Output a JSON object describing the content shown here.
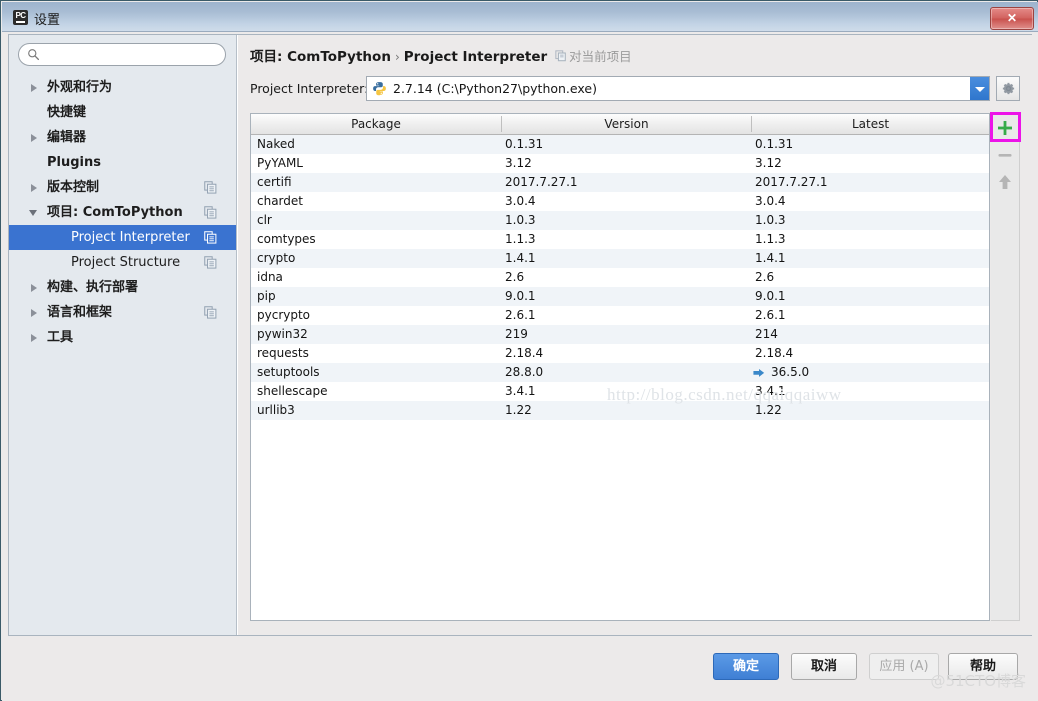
{
  "window": {
    "title": "设置",
    "app_icon": "pycharm-icon",
    "close_label": "✕"
  },
  "sidebar": {
    "search": {
      "value": "",
      "placeholder": "",
      "icon": "search-icon"
    },
    "items": [
      {
        "label": "外观和行为",
        "arrow": "collapsed",
        "bold": true,
        "child": false,
        "selected": false,
        "mod_icon": false
      },
      {
        "label": "快捷键",
        "arrow": "none",
        "bold": true,
        "child": false,
        "selected": false,
        "mod_icon": false
      },
      {
        "label": "编辑器",
        "arrow": "collapsed",
        "bold": true,
        "child": false,
        "selected": false,
        "mod_icon": false
      },
      {
        "label": "Plugins",
        "arrow": "none",
        "bold": true,
        "child": false,
        "selected": false,
        "mod_icon": false
      },
      {
        "label": "版本控制",
        "arrow": "collapsed",
        "bold": true,
        "child": false,
        "selected": false,
        "mod_icon": true
      },
      {
        "label": "项目: ComToPython",
        "arrow": "expanded",
        "bold": true,
        "child": false,
        "selected": false,
        "mod_icon": true
      },
      {
        "label": "Project Interpreter",
        "arrow": "none",
        "bold": false,
        "child": true,
        "selected": true,
        "mod_icon": true
      },
      {
        "label": "Project Structure",
        "arrow": "none",
        "bold": false,
        "child": true,
        "selected": false,
        "mod_icon": true
      },
      {
        "label": "构建、执行部署",
        "arrow": "collapsed",
        "bold": true,
        "child": false,
        "selected": false,
        "mod_icon": false
      },
      {
        "label": "语言和框架",
        "arrow": "collapsed",
        "bold": true,
        "child": false,
        "selected": false,
        "mod_icon": true
      },
      {
        "label": "工具",
        "arrow": "collapsed",
        "bold": true,
        "child": false,
        "selected": false,
        "mod_icon": false
      }
    ]
  },
  "breadcrumb": {
    "project": "项目: ComToPython",
    "separator": "›",
    "page": "Project Interpreter",
    "scope": "对当前项目",
    "scope_icon": "module-icon"
  },
  "interpreter": {
    "label": "Project Interpreter:",
    "value": "2.7.14 (C:\\Python27\\python.exe)",
    "icon": "python-icon",
    "dropdown_icon": "chevron-down-icon",
    "gear_icon": "gear-icon"
  },
  "table": {
    "columns": [
      "Package",
      "Version",
      "Latest"
    ],
    "rows": [
      {
        "package": "Naked",
        "version": "0.1.31",
        "latest": "0.1.31",
        "upgradable": false
      },
      {
        "package": "PyYAML",
        "version": "3.12",
        "latest": "3.12",
        "upgradable": false
      },
      {
        "package": "certifi",
        "version": "2017.7.27.1",
        "latest": "2017.7.27.1",
        "upgradable": false
      },
      {
        "package": "chardet",
        "version": "3.0.4",
        "latest": "3.0.4",
        "upgradable": false
      },
      {
        "package": "clr",
        "version": "1.0.3",
        "latest": "1.0.3",
        "upgradable": false
      },
      {
        "package": "comtypes",
        "version": "1.1.3",
        "latest": "1.1.3",
        "upgradable": false
      },
      {
        "package": "crypto",
        "version": "1.4.1",
        "latest": "1.4.1",
        "upgradable": false
      },
      {
        "package": "idna",
        "version": "2.6",
        "latest": "2.6",
        "upgradable": false
      },
      {
        "package": "pip",
        "version": "9.0.1",
        "latest": "9.0.1",
        "upgradable": false
      },
      {
        "package": "pycrypto",
        "version": "2.6.1",
        "latest": "2.6.1",
        "upgradable": false
      },
      {
        "package": "pywin32",
        "version": "219",
        "latest": "214",
        "upgradable": false
      },
      {
        "package": "requests",
        "version": "2.18.4",
        "latest": "2.18.4",
        "upgradable": false
      },
      {
        "package": "setuptools",
        "version": "28.8.0",
        "latest": "36.5.0",
        "upgradable": true
      },
      {
        "package": "shellescape",
        "version": "3.4.1",
        "latest": "3.4.1",
        "upgradable": false
      },
      {
        "package": "urllib3",
        "version": "1.22",
        "latest": "1.22",
        "upgradable": false
      }
    ]
  },
  "toolbar": {
    "add": {
      "icon": "plus-icon",
      "tooltip": ""
    },
    "remove": {
      "icon": "minus-icon",
      "tooltip": ""
    },
    "upgrade": {
      "icon": "arrow-up-icon",
      "tooltip": ""
    },
    "highlight_color": "#ec13e8"
  },
  "annotation": {
    "arrow_color": "#f4342f"
  },
  "watermarks": {
    "url": "http://blog.csdn.net/qqaiqqaiww",
    "site": "@51CTO博客"
  },
  "buttons": {
    "ok": "确定",
    "cancel": "取消",
    "apply": "应用 (A)",
    "help": "帮助"
  },
  "colors": {
    "titlebar_top": "#9db3cd",
    "titlebar_bottom": "#cfdcea",
    "selection": "#3a73d0",
    "sidebar_bg": "#e4e9ee",
    "row_odd": "#f0f4f8",
    "row_even": "#ffffff",
    "primary_button": "#3f7fd4",
    "close_button": "#c9514d"
  }
}
